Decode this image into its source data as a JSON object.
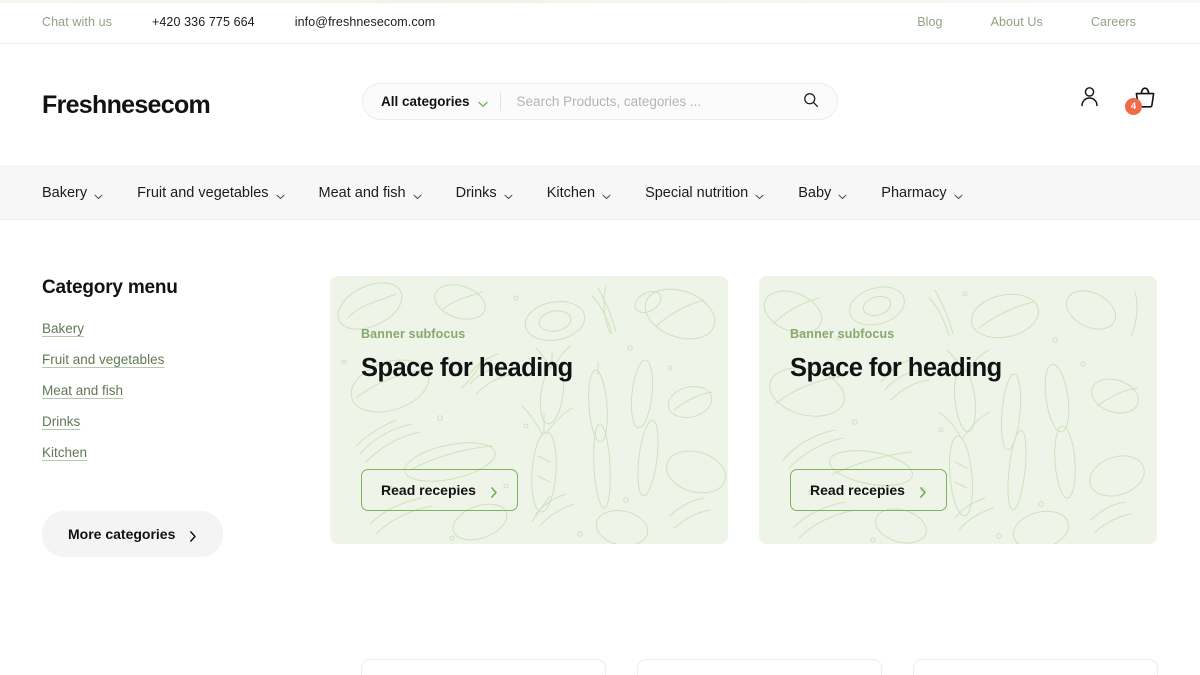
{
  "topbar": {
    "chat": "Chat with us",
    "phone": "+420 336 775 664",
    "email": "info@freshnesecom.com",
    "links": [
      {
        "label": "Blog"
      },
      {
        "label": "About Us"
      },
      {
        "label": "Careers"
      }
    ]
  },
  "header": {
    "logo": "Freshnesecom",
    "search": {
      "category_label": "All categories",
      "placeholder": "Search Products, categories ...",
      "value": ""
    },
    "account_icon": "user-icon",
    "cart_icon": "basket-icon",
    "cart_count": "4"
  },
  "nav": {
    "items": [
      {
        "label": "Bakery"
      },
      {
        "label": "Fruit and vegetables"
      },
      {
        "label": "Meat and fish"
      },
      {
        "label": "Drinks"
      },
      {
        "label": "Kitchen"
      },
      {
        "label": "Special nutrition"
      },
      {
        "label": "Baby"
      },
      {
        "label": "Pharmacy"
      }
    ]
  },
  "sidebar": {
    "title": "Category menu",
    "categories": [
      {
        "label": "Bakery"
      },
      {
        "label": "Fruit and vegetables"
      },
      {
        "label": "Meat and fish"
      },
      {
        "label": "Drinks"
      },
      {
        "label": "Kitchen"
      }
    ],
    "more_button": "More categories"
  },
  "banners": [
    {
      "subfocus": "Banner subfocus",
      "heading": "Space for heading",
      "button": "Read recepies"
    },
    {
      "subfocus": "Banner subfocus",
      "heading": "Space for heading",
      "button": "Read recepies"
    }
  ],
  "colors": {
    "accent_green": "#7fb25f",
    "muted_green": "#8fa383",
    "link_green": "#5f7a52",
    "banner_bg": "#eef4e7",
    "badge_orange": "#ef6b4a",
    "nav_bg": "#f7f7f7",
    "text_dark": "#121212"
  }
}
